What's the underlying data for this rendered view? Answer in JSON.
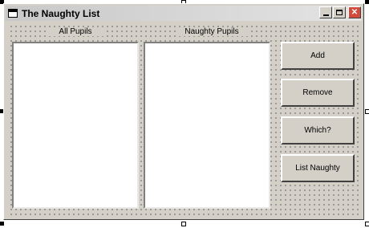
{
  "window": {
    "title": "The Naughty List"
  },
  "titlebar": {
    "minimize_glyph": "",
    "maximize_glyph": "",
    "close_glyph": "✕"
  },
  "labels": {
    "all_pupils": "All Pupils",
    "naughty_pupils": "Naughty Pupils"
  },
  "buttons": {
    "add": "Add",
    "remove": "Remove",
    "which": "Which?",
    "list_naughty": "List Naughty"
  }
}
